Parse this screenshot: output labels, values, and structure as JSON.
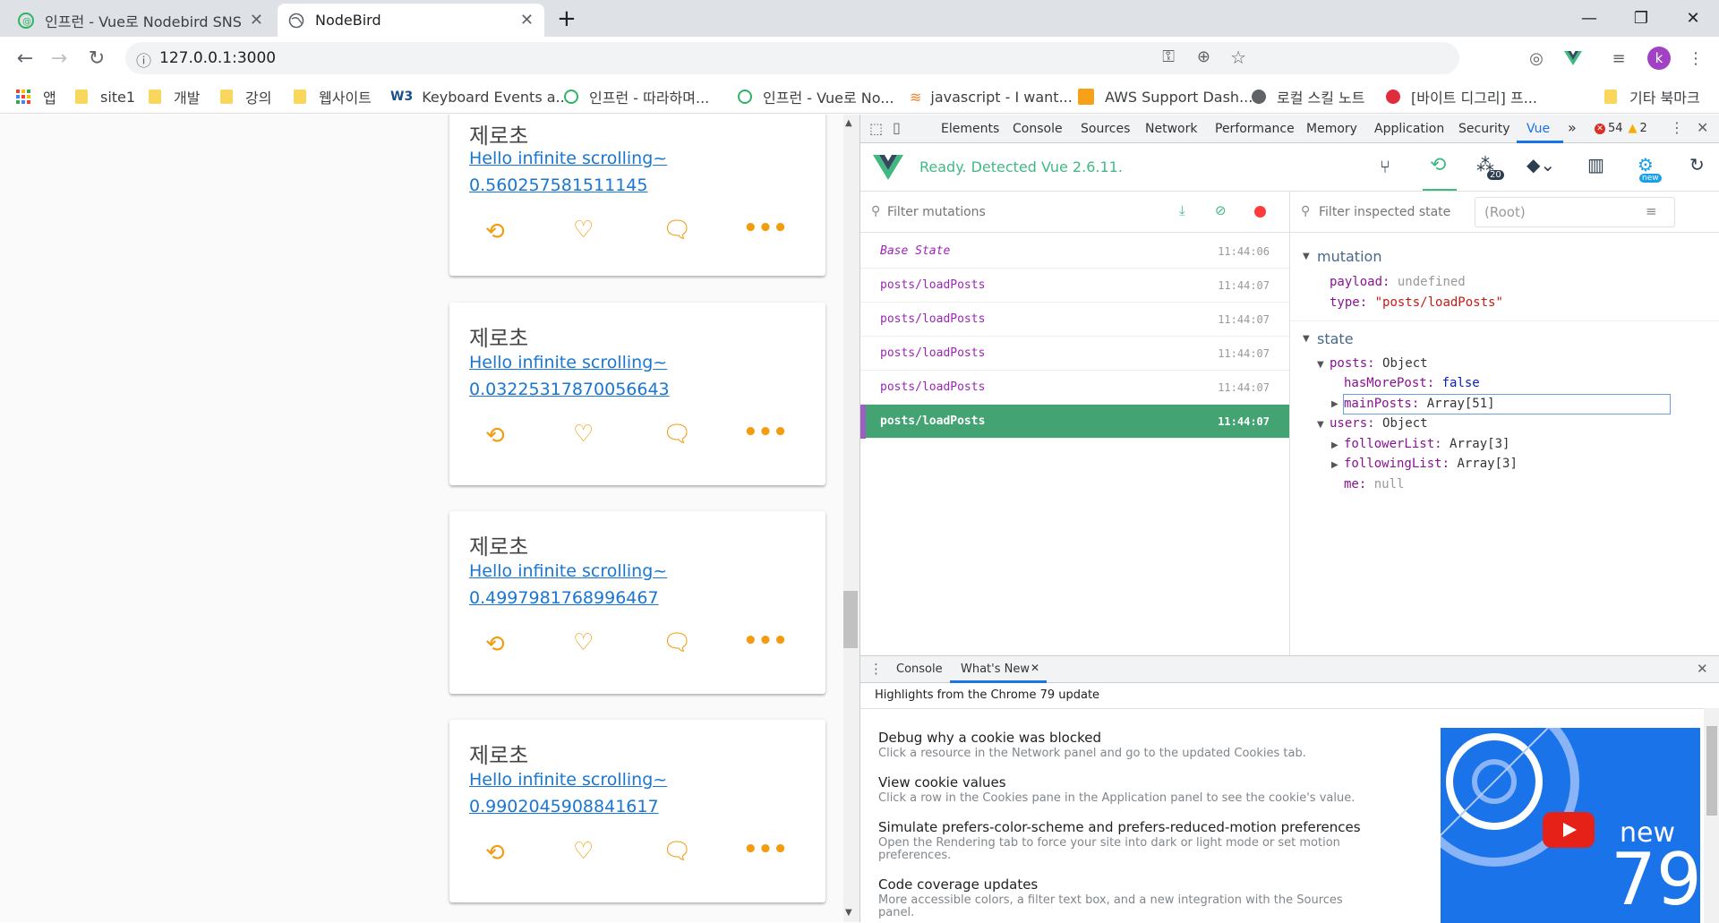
{
  "browser": {
    "tabs": [
      {
        "title": "인프런 - Vue로 Nodebird SNS 만",
        "active": false
      },
      {
        "title": "NodeBird",
        "active": true
      }
    ],
    "new_tab": "+",
    "url": "127.0.0.1:3000",
    "profile_initial": "k"
  },
  "bookmarks": [
    {
      "label": "앱",
      "icon": "apps-icon"
    },
    {
      "label": "site1",
      "icon": "folder-icon"
    },
    {
      "label": "개발",
      "icon": "folder-icon"
    },
    {
      "label": "강의",
      "icon": "folder-icon"
    },
    {
      "label": "웹사이트",
      "icon": "folder-icon"
    },
    {
      "label": "Keyboard Events a...",
      "icon": "w3-icon"
    },
    {
      "label": "인프런 - 따라하며...",
      "icon": "inflearn-icon"
    },
    {
      "label": "인프런 - Vue로 No...",
      "icon": "inflearn-icon"
    },
    {
      "label": "javascript - I want...",
      "icon": "stackoverflow-icon"
    },
    {
      "label": "AWS Support Dash...",
      "icon": "aws-icon"
    },
    {
      "label": "로컬 스킬 노트",
      "icon": "globe-icon"
    },
    {
      "label": "[바이트 디그리] 프...",
      "icon": "byte-icon"
    },
    {
      "label": "기타 북마크",
      "icon": "folder-icon"
    }
  ],
  "posts": [
    {
      "author": "제로초",
      "line1": "Hello infinite scrolling~",
      "line2": "0.560257581511145"
    },
    {
      "author": "제로초",
      "line1": "Hello infinite scrolling~",
      "line2": "0.03225317870056643"
    },
    {
      "author": "제로초",
      "line1": "Hello infinite scrolling~",
      "line2": "0.4997981768996467"
    },
    {
      "author": "제로초",
      "line1": "Hello infinite scrolling~",
      "line2": "0.9902045908841617"
    }
  ],
  "devtools": {
    "tabs": [
      "Elements",
      "Console",
      "Sources",
      "Network",
      "Performance",
      "Memory",
      "Application",
      "Security",
      "Vue"
    ],
    "more": "»",
    "errors": "54",
    "warnings": "2",
    "vue_status": "Ready. Detected Vue 2.6.11.",
    "components_badge": "20",
    "settings_badge": "new",
    "filter_mutations_placeholder": "Filter mutations",
    "filter_state_placeholder": "Filter inspected state",
    "root_label": "(Root)",
    "mutations": [
      {
        "name": "Base State",
        "time": "11:44:06"
      },
      {
        "name": "posts/loadPosts",
        "time": "11:44:07"
      },
      {
        "name": "posts/loadPosts",
        "time": "11:44:07"
      },
      {
        "name": "posts/loadPosts",
        "time": "11:44:07"
      },
      {
        "name": "posts/loadPosts",
        "time": "11:44:07"
      },
      {
        "name": "posts/loadPosts",
        "time": "11:44:07"
      }
    ],
    "inspector": {
      "mutation_header": "mutation",
      "payload_key": "payload:",
      "payload_val": "undefined",
      "type_key": "type:",
      "type_val": "\"posts/loadPosts\"",
      "state_header": "state",
      "posts_key": "posts:",
      "posts_val": "Object",
      "hasMorePost_key": "hasMorePost:",
      "hasMorePost_val": "false",
      "mainPosts_key": "mainPosts:",
      "mainPosts_val": "Array[51]",
      "users_key": "users:",
      "users_val": "Object",
      "followerList_key": "followerList:",
      "followerList_val": "Array[3]",
      "followingList_key": "followingList:",
      "followingList_val": "Array[3]",
      "me_key": "me:",
      "me_val": "null"
    },
    "drawer": {
      "tabs": [
        "Console",
        "What's New"
      ],
      "highlights": "Highlights from the Chrome 79 update",
      "items": [
        {
          "title": "Debug why a cookie was blocked",
          "desc": "Click a resource in the Network panel and go to the updated Cookies tab."
        },
        {
          "title": "View cookie values",
          "desc": "Click a row in the Cookies pane in the Application panel to see the cookie's value."
        },
        {
          "title": "Simulate prefers-color-scheme and prefers-reduced-motion preferences",
          "desc": "Open the Rendering tab to force your site into dark or light mode or set motion preferences."
        },
        {
          "title": "Code coverage updates",
          "desc": "More accessible colors, a filter text box, and a new integration with the Sources panel."
        }
      ],
      "video_text_new": "new",
      "video_text_num": "79"
    }
  }
}
